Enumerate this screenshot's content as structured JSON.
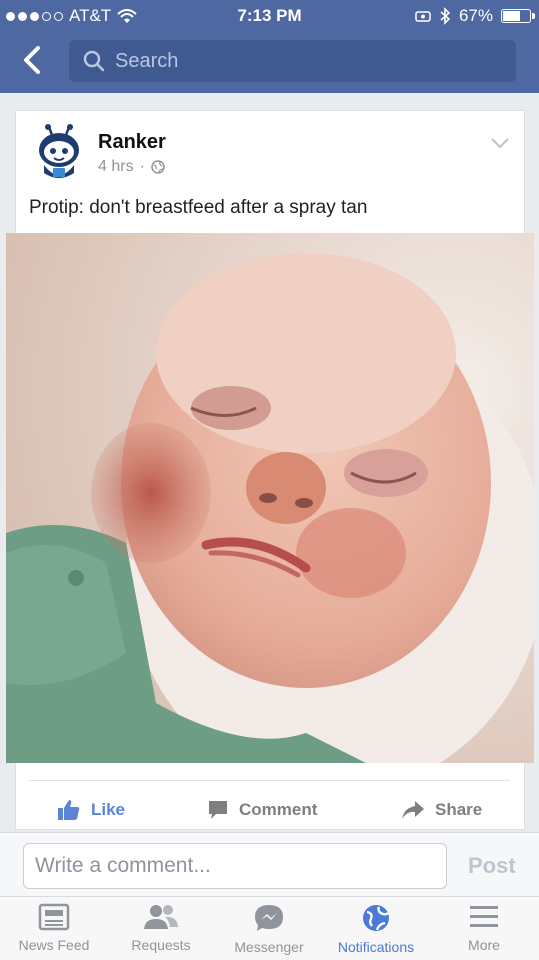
{
  "status_bar": {
    "carrier": "AT&T",
    "time": "7:13 PM",
    "battery": "67%",
    "battery_level": 0.67,
    "icons": [
      "signal-dots",
      "wifi-icon",
      "alarm-icon",
      "bluetooth-icon",
      "battery-icon"
    ]
  },
  "header": {
    "search_placeholder": "Search",
    "back_icon": "chevron-left-icon",
    "search_icon": "magnifier-icon"
  },
  "post": {
    "author": "Ranker",
    "time": "4 hrs",
    "separator": "·",
    "privacy_icon": "globe-icon",
    "text": "Protip: don't breastfeed after a spray tan",
    "menu_icon": "chevron-down-icon"
  },
  "actions": {
    "like": "Like",
    "comment": "Comment",
    "share": "Share"
  },
  "comment_box": {
    "placeholder": "Write a comment...",
    "post_label": "Post"
  },
  "tabs": [
    {
      "label": "News Feed",
      "icon": "news-feed-icon"
    },
    {
      "label": "Requests",
      "icon": "friends-icon"
    },
    {
      "label": "Messenger",
      "icon": "messenger-icon"
    },
    {
      "label": "Notifications",
      "icon": "globe-icon",
      "active": true
    },
    {
      "label": "More",
      "icon": "menu-icon"
    }
  ],
  "colors": {
    "header": "#4e69a2",
    "accent": "#4b7bd6",
    "like": "#5b84d4"
  }
}
